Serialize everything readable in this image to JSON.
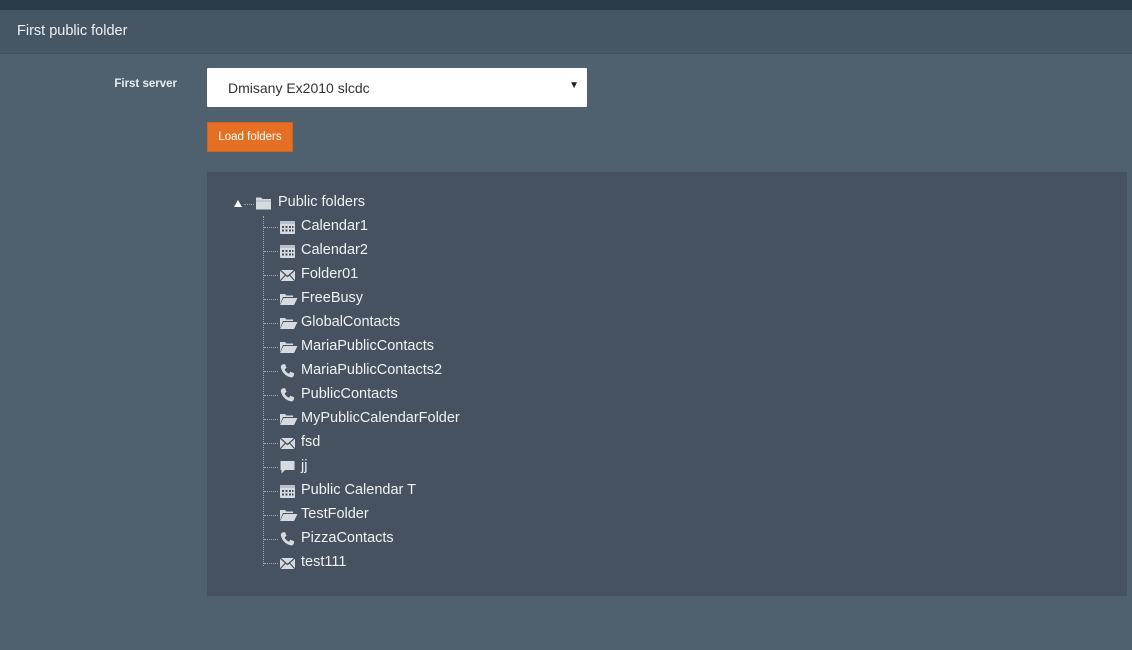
{
  "panel": {
    "title": "First public folder"
  },
  "form": {
    "server_label": "First server",
    "server_selected": "Dmisany Ex2010 slcdc",
    "load_button_label": "Load folders"
  },
  "tree": {
    "root": {
      "label": "Public folders",
      "icon": "folder-closed-icon"
    },
    "children": [
      {
        "label": "Calendar1",
        "icon": "calendar-icon"
      },
      {
        "label": "Calendar2",
        "icon": "calendar-icon"
      },
      {
        "label": "Folder01",
        "icon": "envelope-icon"
      },
      {
        "label": "FreeBusy",
        "icon": "folder-open-icon"
      },
      {
        "label": "GlobalContacts",
        "icon": "folder-open-icon"
      },
      {
        "label": "MariaPublicContacts",
        "icon": "folder-open-icon"
      },
      {
        "label": "MariaPublicContacts2",
        "icon": "phone-icon"
      },
      {
        "label": "PublicContacts",
        "icon": "phone-icon"
      },
      {
        "label": "MyPublicCalendarFolder",
        "icon": "folder-open-icon"
      },
      {
        "label": "fsd",
        "icon": "envelope-icon"
      },
      {
        "label": "jj",
        "icon": "comment-icon"
      },
      {
        "label": "Public Calendar T",
        "icon": "calendar-icon"
      },
      {
        "label": "TestFolder",
        "icon": "folder-open-icon"
      },
      {
        "label": "PizzaContacts",
        "icon": "phone-icon"
      },
      {
        "label": "test111",
        "icon": "envelope-icon"
      }
    ]
  },
  "colors": {
    "background": "#4f606e",
    "header": "#475665",
    "tree_background": "#46525f",
    "accent_button": "#e57024",
    "icon": "#d5dbe0",
    "text": "#eef1f4"
  }
}
